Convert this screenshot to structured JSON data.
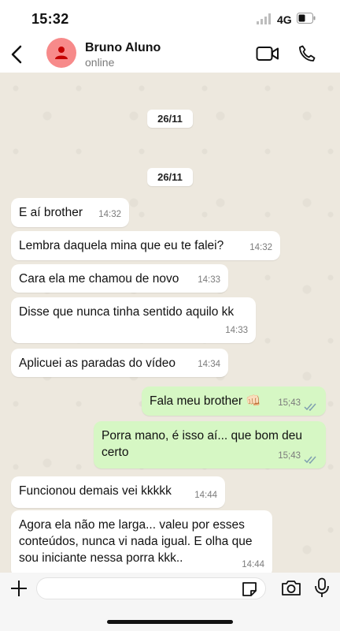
{
  "status_bar": {
    "time": "15:32",
    "network": "4G",
    "icons": [
      "signal-icon",
      "battery-icon"
    ]
  },
  "header": {
    "contact_name": "Bruno Aluno",
    "contact_status": "online",
    "icons": [
      "back-icon",
      "avatar-person-icon",
      "video-call-icon",
      "phone-icon"
    ],
    "avatar_color": "#f78a8a"
  },
  "chat": {
    "date_labels": [
      "26/11",
      "26/11"
    ],
    "messages": [
      {
        "dir": "in",
        "text": "E aí brother",
        "time": "14:32"
      },
      {
        "dir": "in",
        "text": "Lembra daquela mina que eu te falei?",
        "time": "14:32"
      },
      {
        "dir": "in",
        "text": "Cara ela me chamou de novo",
        "time": "14:33"
      },
      {
        "dir": "in",
        "text": "Disse que nunca tinha sentido aquilo kk",
        "time": "14:33"
      },
      {
        "dir": "in",
        "text": "Aplicuei as paradas do vídeo",
        "time": "14:34"
      },
      {
        "dir": "out",
        "text": "Fala meu brother 👊🏻",
        "time": "15;43",
        "read": true
      },
      {
        "dir": "out",
        "text": "Porra mano, é isso aí... que bom deu certo",
        "time": "15;43",
        "read": true
      },
      {
        "dir": "in",
        "text": "Funcionou demais vei kkkkk",
        "time": "14:44"
      },
      {
        "dir": "in",
        "text": "Agora ela não me larga... valeu por esses conteúdos, nunca vi nada igual. E olha que sou iniciante nessa porra kkk..",
        "time": "14:44"
      }
    ],
    "colors": {
      "background": "#ede8de",
      "incoming": "#ffffff",
      "outgoing": "#d6f7c4",
      "read_ticks": "#53a1c9"
    }
  },
  "input_bar": {
    "message_value": "",
    "icons": [
      "plus-icon",
      "sticker-icon",
      "camera-icon",
      "microphone-icon"
    ]
  }
}
